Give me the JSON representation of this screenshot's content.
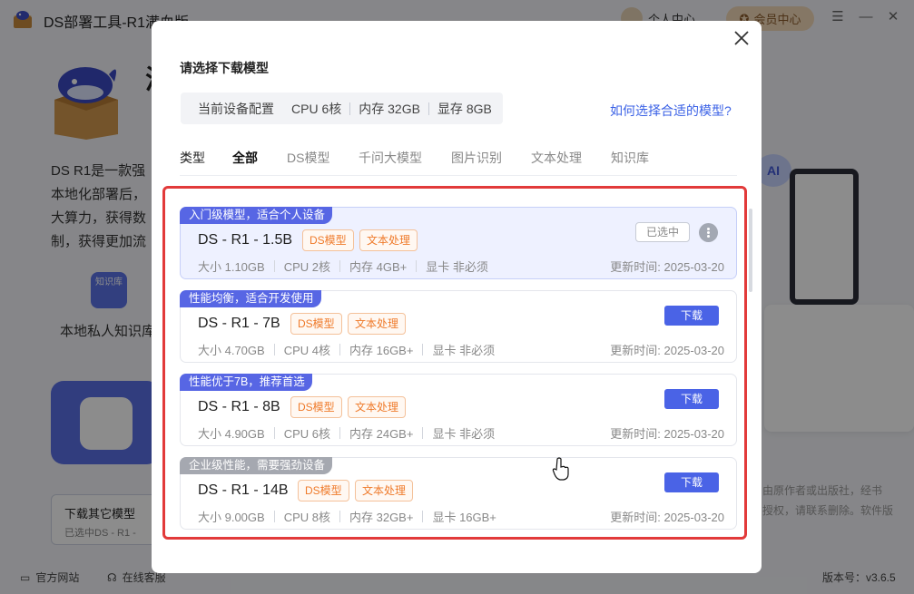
{
  "app": {
    "title": "DS部署工具-R1满血版",
    "user_center": "个人中心",
    "vip_center": "会员中心",
    "window_controls": {
      "menu": "☰",
      "minimize": "—",
      "close": "✕"
    },
    "background": {
      "heading_char": "满",
      "description": "DS R1是一款强大的AI模型，本地化部署后，大算力，获得数据安全，制，获得更加流畅",
      "description_lines": [
        "DS R1是一款强",
        "本地化部署后，",
        "大算力，获得数",
        "制，获得更加流"
      ],
      "kb_icon_label": "知识库",
      "kb_label": "本地私人知识库",
      "download_other_title": "下载其它模型",
      "download_other_sub": "已选中DS - R1 -",
      "right_text_lines": [
        "由原作者或出版社，经书",
        "授权，请联系删除。软件版"
      ]
    },
    "footer": {
      "website": "官方网站",
      "support": "在线客服",
      "version": "版本号：v3.6.5"
    }
  },
  "modal": {
    "title": "请选择下载模型",
    "device_config": {
      "label": "当前设备配置",
      "cpu": "CPU 6核",
      "memory": "内存 32GB",
      "vram": "显存 8GB"
    },
    "help_link": "如何选择合适的模型?",
    "tabs": {
      "type_label": "类型",
      "items": [
        "全部",
        "DS模型",
        "千问大模型",
        "图片识别",
        "文本处理",
        "知识库"
      ],
      "active": "全部"
    },
    "selected_badge": "已选中",
    "download_label": "下载",
    "models": [
      {
        "ribbon": "入门级模型，适合个人设备",
        "name": "DS - R1 - 1.5B",
        "tags": [
          "DS模型",
          "文本处理"
        ],
        "size": "大小 1.10GB",
        "cpu": "CPU 2核",
        "memory": "内存 4GB+",
        "gpu": "显卡 非必须",
        "updated": "更新时间:  2025-03-20",
        "selected": true
      },
      {
        "ribbon": "性能均衡，适合开发使用",
        "name": "DS - R1 - 7B",
        "tags": [
          "DS模型",
          "文本处理"
        ],
        "size": "大小 4.70GB",
        "cpu": "CPU 4核",
        "memory": "内存 16GB+",
        "gpu": "显卡 非必须",
        "updated": "更新时间:  2025-03-20",
        "selected": false
      },
      {
        "ribbon": "性能优于7B，推荐首选",
        "name": "DS - R1 - 8B",
        "tags": [
          "DS模型",
          "文本处理"
        ],
        "size": "大小 4.90GB",
        "cpu": "CPU 6核",
        "memory": "内存 24GB+",
        "gpu": "显卡 非必须",
        "updated": "更新时间:  2025-03-20",
        "selected": false
      },
      {
        "ribbon": "企业级性能，需要强劲设备",
        "name": "DS - R1 - 14B",
        "tags": [
          "DS模型",
          "文本处理"
        ],
        "size": "大小 9.00GB",
        "cpu": "CPU 8核",
        "memory": "内存 32GB+",
        "gpu": "显卡 16GB+",
        "updated": "更新时间:  2025-03-20",
        "selected": false
      }
    ]
  },
  "colors": {
    "accent": "#4a63e6",
    "ribbon_blue": "#5766e4",
    "ribbon_gray": "#a5a8b0",
    "tag_orange": "#ef7a2a",
    "highlight_frame": "#e23a3a",
    "selected_card_bg": "#eef1ff"
  },
  "icons": {
    "close": "close-icon",
    "more": "more-options-icon",
    "cursor": "hand-pointer-icon",
    "website": "monitor-icon",
    "support": "headset-icon"
  }
}
